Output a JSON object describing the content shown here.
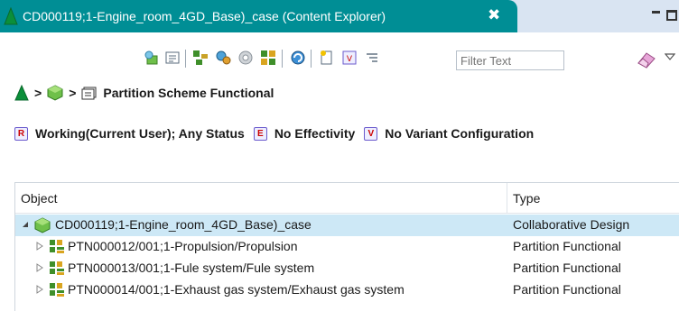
{
  "tab": {
    "title": "CD000119;1-Engine_room_4GD_Base)_case (Content Explorer)",
    "close": "✖",
    "accent": "#008e95"
  },
  "toolbar": {
    "filter_placeholder": "Filter Text",
    "icons": [
      "pin-tree-icon",
      "properties-icon",
      "structure-icon",
      "configure-icon",
      "settings-icon",
      "grid-icon",
      "refresh-icon",
      "new-object-icon",
      "revision-rule-icon",
      "filter-list-icon",
      "eraser-icon",
      "view-menu-icon"
    ]
  },
  "breadcrumb": {
    "separator": ">",
    "current": "Partition Scheme Functional"
  },
  "status": {
    "revision_rule": "Working(Current User); Any Status",
    "effectivity": "No Effectivity",
    "variant": "No Variant Configuration"
  },
  "table": {
    "columns": {
      "object": "Object",
      "type": "Type"
    },
    "rows": [
      {
        "label": "CD000119;1-Engine_room_4GD_Base)_case",
        "type": "Collaborative Design",
        "expanded": true,
        "selected": true
      },
      {
        "label": "PTN000012/001;1-Propulsion/Propulsion",
        "type": "Partition Functional",
        "expanded": false,
        "selected": false
      },
      {
        "label": "PTN000013/001;1-Fule system/Fule system",
        "type": "Partition Functional",
        "expanded": false,
        "selected": false
      },
      {
        "label": "PTN000014/001;1-Exhaust gas system/Exhaust gas system",
        "type": "Partition Functional",
        "expanded": false,
        "selected": false
      }
    ]
  }
}
